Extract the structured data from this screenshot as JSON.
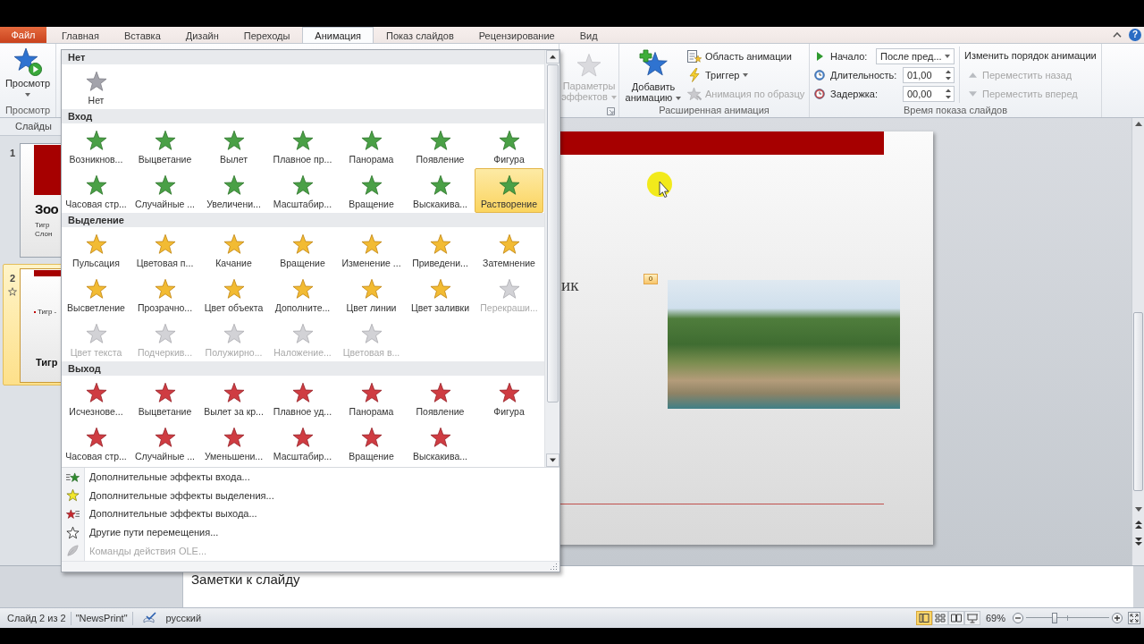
{
  "ribbon_tabs": [
    {
      "label": "Файл",
      "kind": "file",
      "selected": false
    },
    {
      "label": "Главная",
      "kind": "tab",
      "selected": false
    },
    {
      "label": "Вставка",
      "kind": "tab",
      "selected": false
    },
    {
      "label": "Дизайн",
      "kind": "tab",
      "selected": false
    },
    {
      "label": "Переходы",
      "kind": "tab",
      "selected": false
    },
    {
      "label": "Анимация",
      "kind": "tab",
      "selected": true
    },
    {
      "label": "Показ слайдов",
      "kind": "tab",
      "selected": false
    },
    {
      "label": "Рецензирование",
      "kind": "tab",
      "selected": false
    },
    {
      "label": "Вид",
      "kind": "tab",
      "selected": false
    }
  ],
  "window_controls": {
    "help": "?"
  },
  "ribbon": {
    "preview": {
      "label": "Просмотр",
      "group_label": "Просмотр"
    },
    "effect_options": {
      "label": "Параметры эффектов",
      "disabled": true
    },
    "advanced_animation": {
      "add_button": "Добавить анимацию",
      "commands": [
        {
          "kind": "pane",
          "label": "Область анимации",
          "disabled": false,
          "dropdown": false
        },
        {
          "kind": "trigger",
          "label": "Триггер",
          "disabled": false,
          "dropdown": true
        },
        {
          "kind": "painter",
          "label": "Анимация по образцу",
          "disabled": true,
          "dropdown": false
        }
      ],
      "group_label": "Расширенная анимация"
    },
    "timing": {
      "fields": [
        {
          "kind": "dropdown",
          "label": "Начало:",
          "value": "После пред..."
        },
        {
          "kind": "spin",
          "label": "Длительность:",
          "value": "01,00"
        },
        {
          "kind": "spin",
          "label": "Задержка:",
          "value": "00,00"
        }
      ],
      "reorder_title": "Изменить порядок анимации",
      "reorder_commands": [
        {
          "kind": "up",
          "label": "Переместить назад",
          "disabled": true
        },
        {
          "kind": "down",
          "label": "Переместить вперед",
          "disabled": true
        }
      ],
      "group_label": "Время показа слайдов"
    }
  },
  "slides_pane": {
    "tab": "Слайды",
    "slides": [
      {
        "number": "1",
        "selected": false,
        "animated": false,
        "kind": "title",
        "heading": "Зоо",
        "lines": [
          "Тигр",
          "Слон"
        ]
      },
      {
        "number": "2",
        "selected": true,
        "animated": true,
        "kind": "content",
        "heading": "Тигр",
        "lines": [
          "Тигр -"
        ]
      }
    ]
  },
  "slide": {
    "fragment": "ик",
    "animation_badge": "0"
  },
  "effects_gallery": {
    "sections": [
      {
        "title": "Нет",
        "kind": "none",
        "effects": [
          {
            "label": "Нет",
            "selected": false,
            "disabled": false
          }
        ]
      },
      {
        "title": "Вход",
        "kind": "entrance",
        "effects": [
          {
            "label": "Возникнов...",
            "selected": false,
            "disabled": false
          },
          {
            "label": "Выцветание",
            "selected": false,
            "disabled": false
          },
          {
            "label": "Вылет",
            "selected": false,
            "disabled": false
          },
          {
            "label": "Плавное пр...",
            "selected": false,
            "disabled": false
          },
          {
            "label": "Панорама",
            "selected": false,
            "disabled": false
          },
          {
            "label": "Появление",
            "selected": false,
            "disabled": false
          },
          {
            "label": "Фигура",
            "selected": false,
            "disabled": false
          },
          {
            "label": "Часовая стр...",
            "selected": false,
            "disabled": false
          },
          {
            "label": "Случайные ...",
            "selected": false,
            "disabled": false
          },
          {
            "label": "Увеличени...",
            "selected": false,
            "disabled": false
          },
          {
            "label": "Масштабир...",
            "selected": false,
            "disabled": false
          },
          {
            "label": "Вращение",
            "selected": false,
            "disabled": false
          },
          {
            "label": "Выскакива...",
            "selected": false,
            "disabled": false
          },
          {
            "label": "Растворение",
            "selected": true,
            "disabled": false
          }
        ]
      },
      {
        "title": "Выделение",
        "kind": "emphasis",
        "effects": [
          {
            "label": "Пульсация",
            "selected": false,
            "disabled": false
          },
          {
            "label": "Цветовая п...",
            "selected": false,
            "disabled": false
          },
          {
            "label": "Качание",
            "selected": false,
            "disabled": false
          },
          {
            "label": "Вращение",
            "selected": false,
            "disabled": false
          },
          {
            "label": "Изменение ...",
            "selected": false,
            "disabled": false
          },
          {
            "label": "Приведени...",
            "selected": false,
            "disabled": false
          },
          {
            "label": "Затемнение",
            "selected": false,
            "disabled": false
          },
          {
            "label": "Высветление",
            "selected": false,
            "disabled": false
          },
          {
            "label": "Прозрачно...",
            "selected": false,
            "disabled": false
          },
          {
            "label": "Цвет объекта",
            "selected": false,
            "disabled": false
          },
          {
            "label": "Дополните...",
            "selected": false,
            "disabled": false
          },
          {
            "label": "Цвет линии",
            "selected": false,
            "disabled": false
          },
          {
            "label": "Цвет заливки",
            "selected": false,
            "disabled": false
          },
          {
            "label": "Перекраши...",
            "selected": false,
            "disabled": true
          },
          {
            "label": "Цвет текста",
            "selected": false,
            "disabled": true
          },
          {
            "label": "Подчеркив...",
            "selected": false,
            "disabled": true
          },
          {
            "label": "Полужирно...",
            "selected": false,
            "disabled": true
          },
          {
            "label": "Наложение...",
            "selected": false,
            "disabled": true
          },
          {
            "label": "Цветовая в...",
            "selected": false,
            "disabled": true
          }
        ]
      },
      {
        "title": "Выход",
        "kind": "exit",
        "effects": [
          {
            "label": "Исчезнове...",
            "selected": false,
            "disabled": false
          },
          {
            "label": "Выцветание",
            "selected": false,
            "disabled": false
          },
          {
            "label": "Вылет за кр...",
            "selected": false,
            "disabled": false
          },
          {
            "label": "Плавное уд...",
            "selected": false,
            "disabled": false
          },
          {
            "label": "Панорама",
            "selected": false,
            "disabled": false
          },
          {
            "label": "Появление",
            "selected": false,
            "disabled": false
          },
          {
            "label": "Фигура",
            "selected": false,
            "disabled": false
          },
          {
            "label": "Часовая стр...",
            "selected": false,
            "disabled": false
          },
          {
            "label": "Случайные ...",
            "selected": false,
            "disabled": false
          },
          {
            "label": "Уменьшени...",
            "selected": false,
            "disabled": false
          },
          {
            "label": "Масштабир...",
            "selected": false,
            "disabled": false
          },
          {
            "label": "Вращение",
            "selected": false,
            "disabled": false
          },
          {
            "label": "Выскакива...",
            "selected": false,
            "disabled": false
          }
        ]
      }
    ],
    "menu": [
      {
        "kind": "entrance",
        "label": "Дополнительные эффекты входа...",
        "disabled": false
      },
      {
        "kind": "emphasis",
        "label": "Дополнительные эффекты выделения...",
        "disabled": false
      },
      {
        "kind": "exit",
        "label": "Дополнительные эффекты выхода...",
        "disabled": false
      },
      {
        "kind": "path",
        "label": "Другие пути перемещения...",
        "disabled": false
      },
      {
        "kind": "ole",
        "label": "Команды действия OLE...",
        "disabled": true
      }
    ]
  },
  "notes": {
    "placeholder": "Заметки к слайду"
  },
  "status_bar": {
    "slide_info": "Слайд 2 из 2",
    "theme": "\"NewsPrint\"",
    "language": "русский",
    "views": [
      {
        "kind": "normal",
        "selected": true
      },
      {
        "kind": "sorter",
        "selected": false
      },
      {
        "kind": "reading",
        "selected": false
      },
      {
        "kind": "slideshow",
        "selected": false
      }
    ],
    "zoom": "69%",
    "zoom_slider": {
      "level": 0.34
    }
  }
}
